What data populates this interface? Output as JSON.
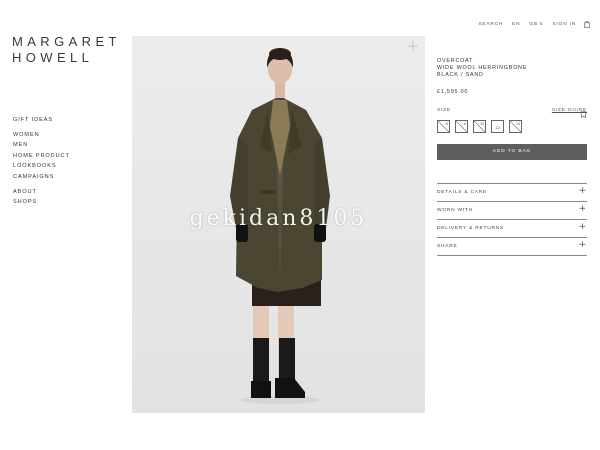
{
  "brand": {
    "line1": "MARGARET",
    "line2": "HOWELL"
  },
  "utility": {
    "search": "SEARCH",
    "lang": "EN",
    "currency": "GB £",
    "signin": "SIGN IN",
    "bag_icon": "shopping-bag-icon"
  },
  "nav": {
    "group1": [
      "GIFT IDEAS"
    ],
    "group2": [
      "WOMEN",
      "MEN",
      "HOME PRODUCT",
      "LOOKBOOKS",
      "CAMPAIGNS"
    ],
    "group3": [
      "ABOUT",
      "SHOPS"
    ]
  },
  "photo": {
    "watermark": "gekidan8105",
    "zoom_icon": "plus-icon"
  },
  "product": {
    "name_line1": "OVERCOAT",
    "name_line2": "WIDE WOOL HERRINGBONE",
    "name_line3": "BLACK / SAND",
    "price": "£1,595.00",
    "size_label": "SIZE",
    "size_guide": "SIZE GUIDE",
    "sizes": [
      {
        "label": "6",
        "available": false
      },
      {
        "label": "8",
        "available": false
      },
      {
        "label": "10",
        "available": false
      },
      {
        "label": "12",
        "available": true
      },
      {
        "label": "14",
        "available": false
      }
    ],
    "add_to_bag": "ADD TO BAG"
  },
  "accordion": [
    "DETAILS & CARE",
    "WORN WITH",
    "DELIVERY & RETURNS",
    "SHARE"
  ],
  "colors": {
    "button": "#5e5e5e",
    "photo_bg": "#e8e8e8",
    "coat": "#4a4631"
  }
}
